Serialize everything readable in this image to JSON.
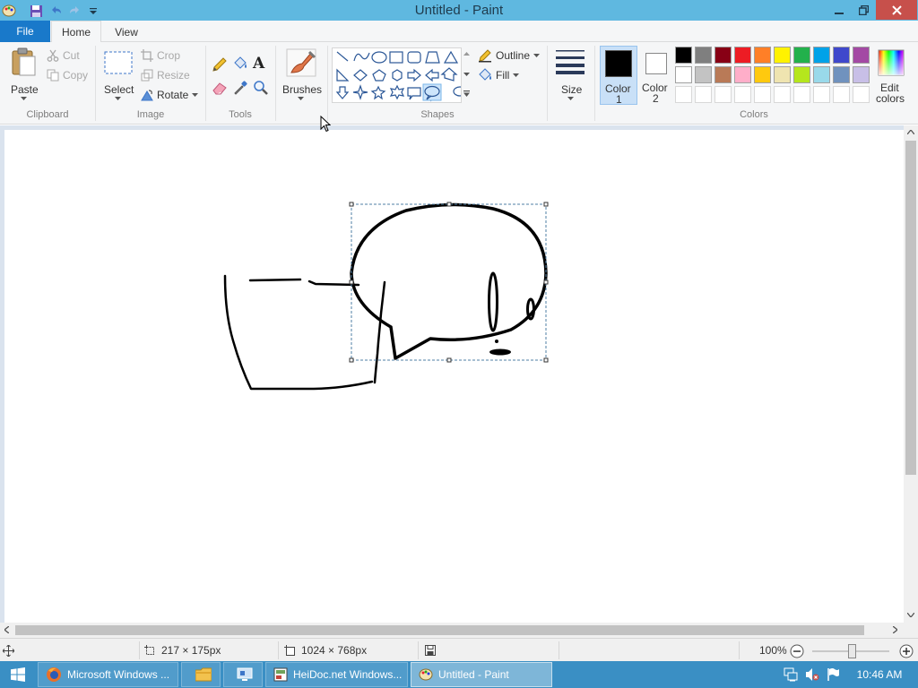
{
  "titlebar": {
    "title": "Untitled - Paint"
  },
  "tabs": {
    "file": "File",
    "home": "Home",
    "view": "View"
  },
  "clipboard": {
    "paste": "Paste",
    "cut": "Cut",
    "copy": "Copy",
    "label": "Clipboard"
  },
  "image": {
    "select": "Select",
    "crop": "Crop",
    "resize": "Resize",
    "rotate": "Rotate",
    "label": "Image"
  },
  "tools": {
    "label": "Tools",
    "text_tool_glyph": "A"
  },
  "brushes": {
    "label": "Brushes"
  },
  "shapes": {
    "outline": "Outline",
    "fill": "Fill",
    "label": "Shapes"
  },
  "size": {
    "label": "Size"
  },
  "colors": {
    "color1": "Color",
    "color1_num": "1",
    "color2": "Color",
    "color2_num": "2",
    "edit": "Edit",
    "edit2": "colors",
    "label": "Colors",
    "color1_value": "#000000",
    "color2_value": "#ffffff",
    "palette_row1": [
      "#000000",
      "#7f7f7f",
      "#880015",
      "#ed1c24",
      "#ff7f27",
      "#fff200",
      "#22b14c",
      "#00a2e8",
      "#3f48cc",
      "#a349a4"
    ],
    "palette_row2": [
      "#ffffff",
      "#c3c3c3",
      "#b97a57",
      "#ffaec9",
      "#ffc90e",
      "#efe4b0",
      "#b5e61d",
      "#99d9ea",
      "#7092be",
      "#c8bfe7"
    ]
  },
  "status": {
    "selection_size": "217 × 175px",
    "image_size": "1024 × 768px",
    "zoom": "100%"
  },
  "taskbar": {
    "firefox": "Microsoft Windows ...",
    "heidoc": "HeiDoc.net Windows...",
    "paint": "Untitled - Paint",
    "clock": "10:46 AM"
  },
  "icons": [
    "paint-app-icon",
    "save-icon",
    "undo-icon",
    "redo-icon",
    "customize-qat-icon",
    "minimize-icon",
    "restore-icon",
    "close-icon",
    "paste-icon",
    "cut-icon",
    "copy-icon",
    "select-icon",
    "crop-icon",
    "resize-icon",
    "rotate-icon",
    "pencil-icon",
    "fill-bucket-icon",
    "text-icon",
    "eraser-icon",
    "color-picker-icon",
    "magnifier-icon",
    "brush-icon",
    "outline-icon",
    "fill-icon",
    "size-icon",
    "edit-colors-icon",
    "move-cursor-icon",
    "selection-icon",
    "canvas-size-icon",
    "disk-icon",
    "zoom-out-icon",
    "zoom-in-icon",
    "windows-start-icon",
    "firefox-icon",
    "file-explorer-icon",
    "control-panel-icon",
    "heidoc-icon",
    "network-icon",
    "mute-icon",
    "flag-icon",
    "mouse-cursor-icon"
  ]
}
